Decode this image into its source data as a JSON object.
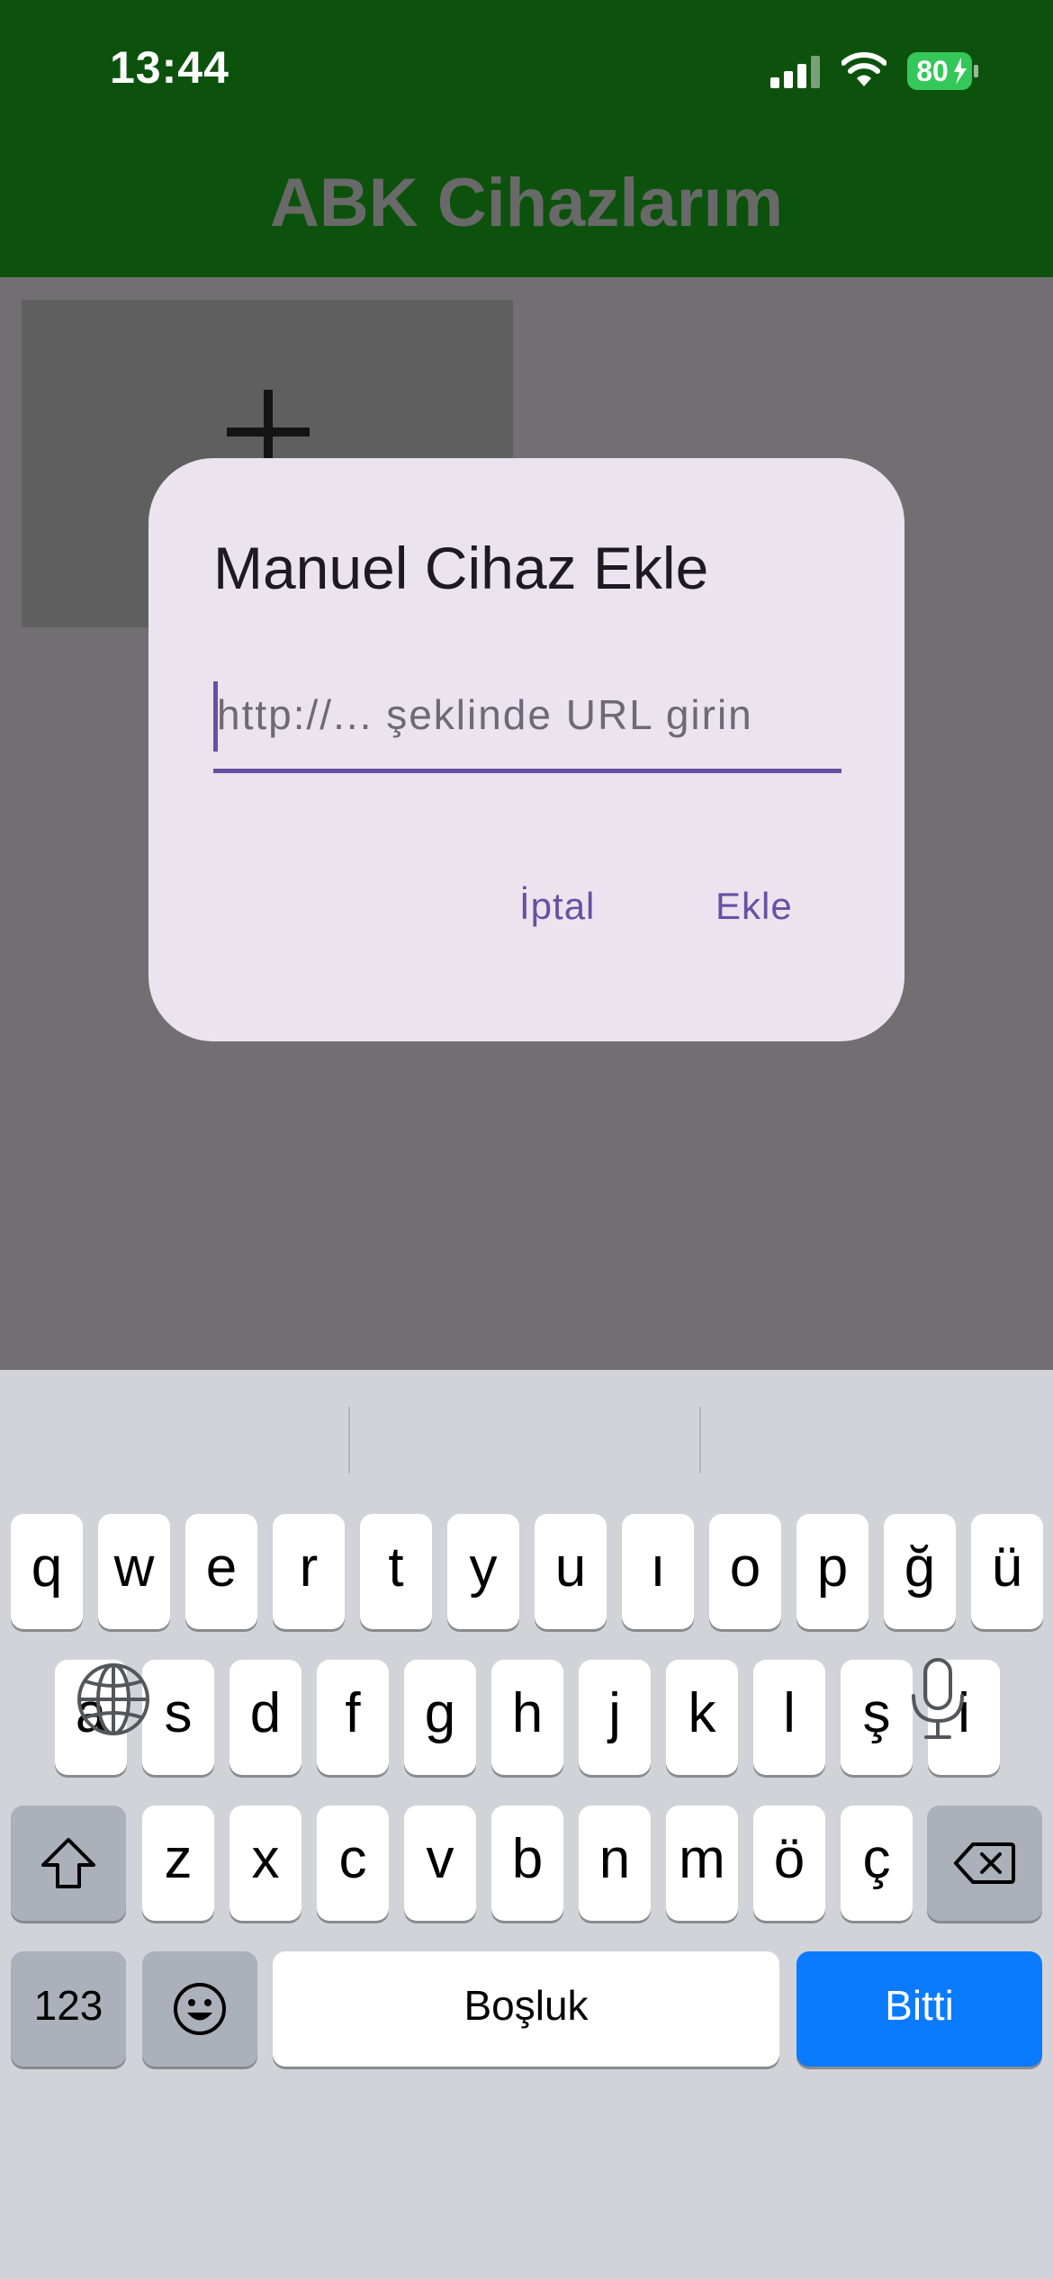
{
  "status_bar": {
    "time": "13:44",
    "battery": "80"
  },
  "app": {
    "title": "ABK Cihazlarım"
  },
  "dialog": {
    "title": "Manuel Cihaz Ekle",
    "url_placeholder": "http://... şeklinde URL girin",
    "cancel_label": "İptal",
    "add_label": "Ekle"
  },
  "keyboard": {
    "row1": [
      "q",
      "w",
      "e",
      "r",
      "t",
      "y",
      "u",
      "ı",
      "o",
      "p",
      "ğ",
      "ü"
    ],
    "row2": [
      "a",
      "s",
      "d",
      "f",
      "g",
      "h",
      "j",
      "k",
      "l",
      "ş",
      "i"
    ],
    "row3": [
      "z",
      "x",
      "c",
      "v",
      "b",
      "n",
      "m",
      "ö",
      "ç"
    ],
    "numbers_label": "123",
    "space_label": "Boşluk",
    "done_label": "Bitti"
  },
  "icons": {
    "signal": "cellular-signal-icon",
    "wifi": "wifi-icon",
    "battery": "battery-charging-icon",
    "add": "plus-icon",
    "shift": "shift-icon",
    "delete": "backspace-icon",
    "emoji": "emoji-icon",
    "globe": "globe-icon",
    "mic": "microphone-icon"
  },
  "colors": {
    "app_bar": "#0c520c",
    "accent": "#6750a4",
    "dialog_bg": "#ebe4ef",
    "done_key": "#0a7aff"
  }
}
